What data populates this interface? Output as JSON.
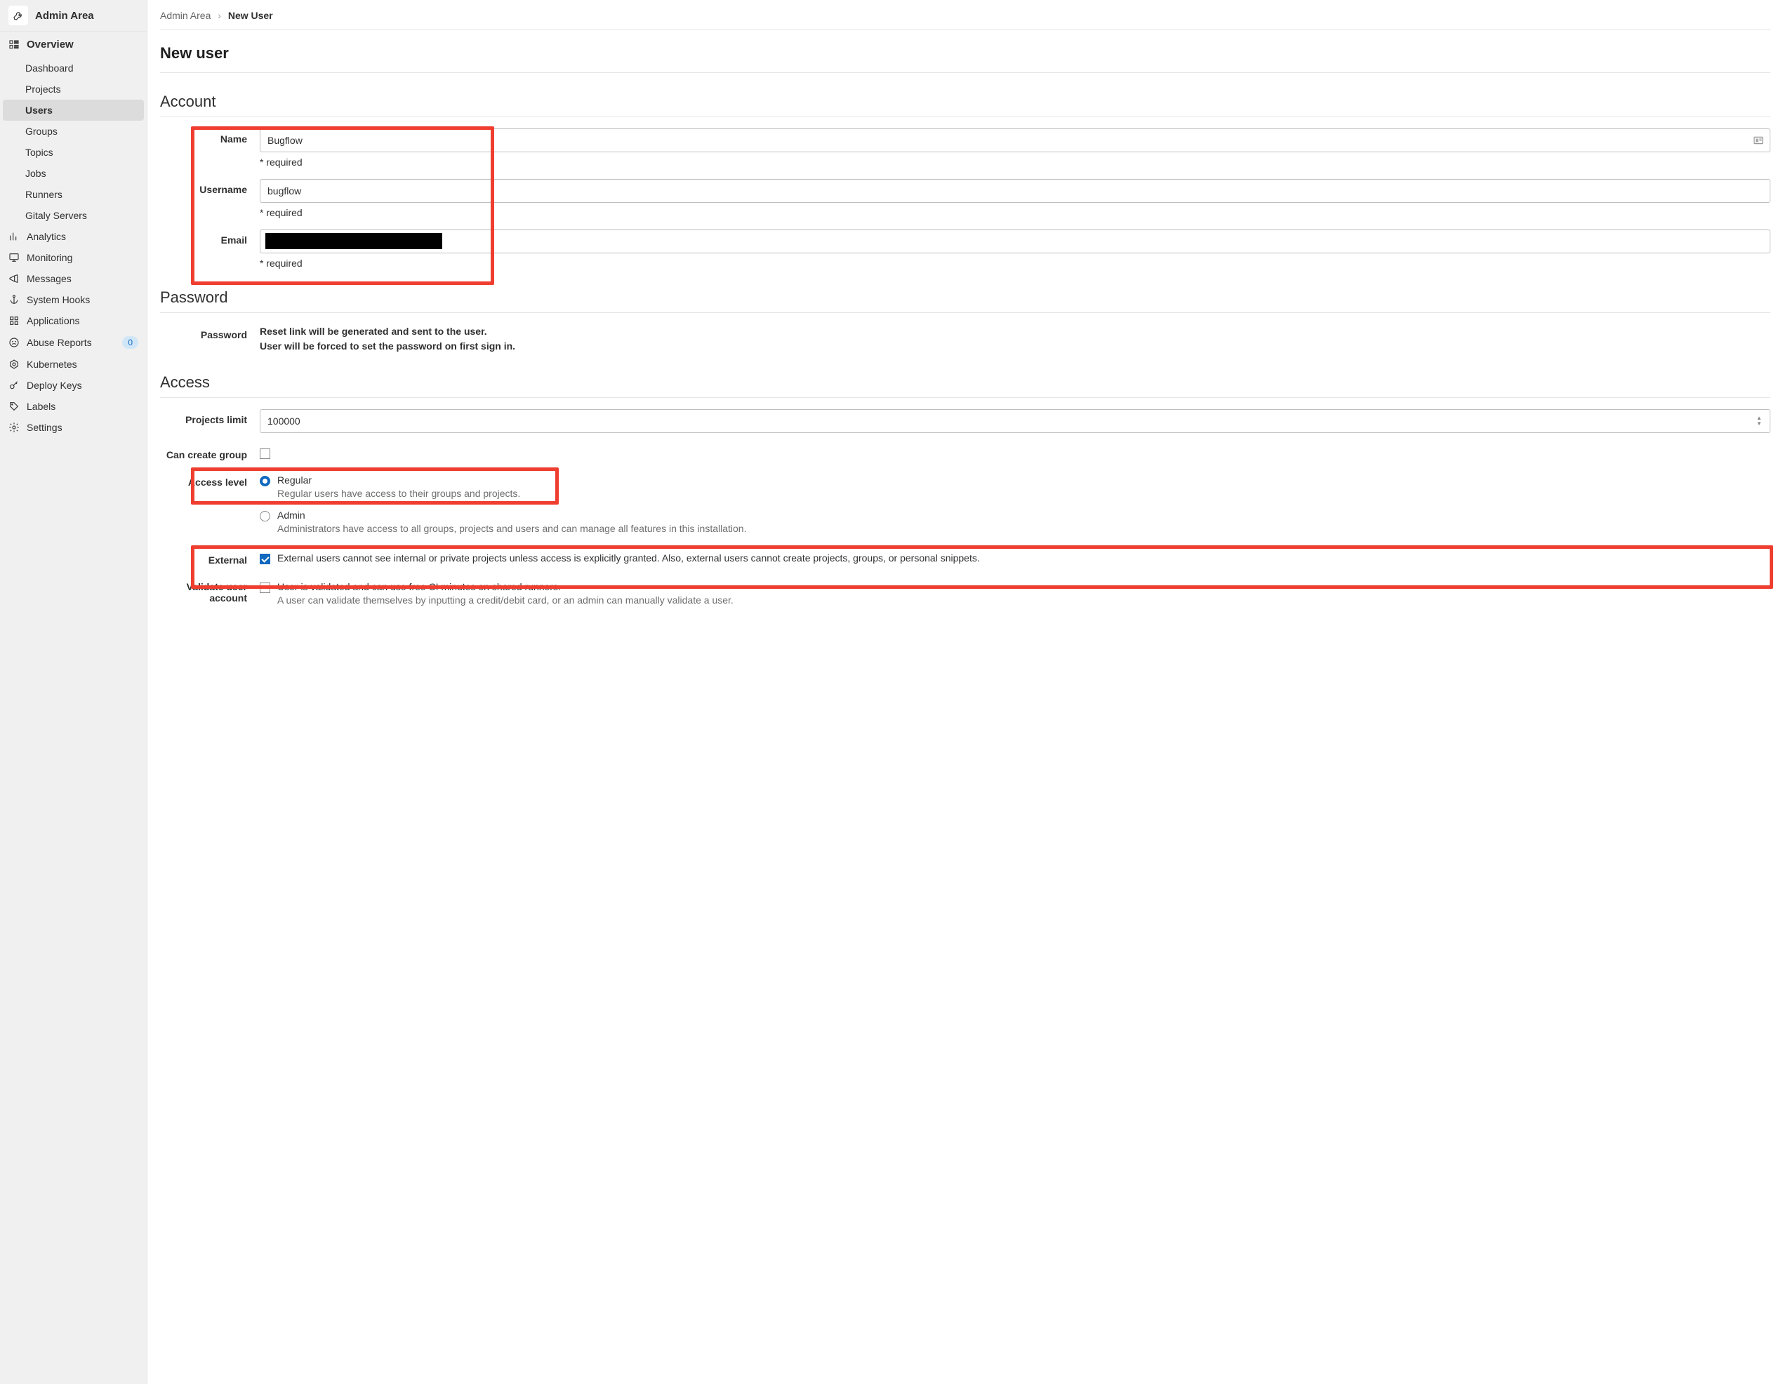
{
  "sidebar": {
    "header_title": "Admin Area",
    "overview_label": "Overview",
    "items_overview": [
      {
        "label": "Dashboard"
      },
      {
        "label": "Projects"
      },
      {
        "label": "Users",
        "active": true
      },
      {
        "label": "Groups"
      },
      {
        "label": "Topics"
      },
      {
        "label": "Jobs"
      },
      {
        "label": "Runners"
      },
      {
        "label": "Gitaly Servers"
      }
    ],
    "items_main": [
      {
        "label": "Analytics",
        "icon": "analytics"
      },
      {
        "label": "Monitoring",
        "icon": "monitor"
      },
      {
        "label": "Messages",
        "icon": "megaphone"
      },
      {
        "label": "System Hooks",
        "icon": "anchor"
      },
      {
        "label": "Applications",
        "icon": "apps"
      },
      {
        "label": "Abuse Reports",
        "icon": "sad-face",
        "badge": "0"
      },
      {
        "label": "Kubernetes",
        "icon": "kube"
      },
      {
        "label": "Deploy Keys",
        "icon": "key"
      },
      {
        "label": "Labels",
        "icon": "tag"
      },
      {
        "label": "Settings",
        "icon": "gear"
      }
    ]
  },
  "breadcrumb": {
    "root": "Admin Area",
    "current": "New User"
  },
  "page_title": "New user",
  "sections": {
    "account": {
      "title": "Account",
      "name_label": "Name",
      "name_value": "Bugflow",
      "username_label": "Username",
      "username_value": "bugflow",
      "email_label": "Email",
      "email_value": "",
      "required_hint": "* required"
    },
    "password": {
      "title": "Password",
      "label": "Password",
      "line1": "Reset link will be generated and sent to the user.",
      "line2": "User will be forced to set the password on first sign in."
    },
    "access": {
      "title": "Access",
      "projects_limit_label": "Projects limit",
      "projects_limit_value": "100000",
      "can_create_group_label": "Can create group",
      "can_create_group_checked": false,
      "access_level_label": "Access level",
      "regular_label": "Regular",
      "regular_desc": "Regular users have access to their groups and projects.",
      "admin_label": "Admin",
      "admin_desc": "Administrators have access to all groups, projects and users and can manage all features in this installation.",
      "external_label": "External",
      "external_checked": true,
      "external_desc": "External users cannot see internal or private projects unless access is explicitly granted. Also, external users cannot create projects, groups, or personal snippets.",
      "validate_label": "Validate user account",
      "validate_checked": false,
      "validate_opt": "User is validated and can use free CI minutes on shared runners.",
      "validate_desc": "A user can validate themselves by inputting a credit/debit card, or an admin can manually validate a user."
    }
  }
}
